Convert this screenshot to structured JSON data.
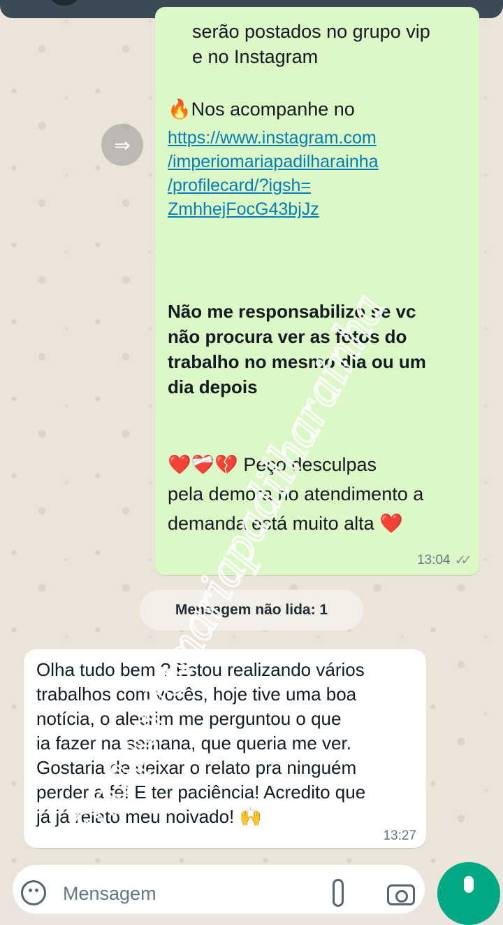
{
  "outgoing": {
    "lines_top": [
      "serão postados no grupo vip",
      "e no Instagram"
    ],
    "follow_emoji": "🔥",
    "follow_text": "Nos acompanhe no",
    "link_lines": [
      "https://www.instagram.com",
      "/imperiomariapadilharainha",
      "/profilecard/?igsh=",
      "ZmhhejFocG43bjJz"
    ],
    "bold_lines": [
      "Não me responsabilizo se vc",
      "não procura ver as fotos do",
      "trabalho no mesmo dia ou um",
      "dia depois"
    ],
    "apology_emojis": "❤️❤️‍🩹💔",
    "apology_lines": [
      "Peço desculpas",
      "pela demora no atendimento a",
      "demanda está muito alta"
    ],
    "apology_end_emoji": "❤️",
    "time": "13:04",
    "read_ticks": "✓✓"
  },
  "unread_label": "Mensagem não lida: 1",
  "incoming": {
    "lines": [
      "Olha tudo bem ? Estou realizando vários",
      "trabalhos com vocês, hoje tive uma boa",
      "notícia, o alecrim me perguntou o que",
      "ia fazer na semana, que queria me ver.",
      "Gostaria de deixar o relato pra ninguém",
      "perder a fé! E ter paciência! Acredito que",
      "já já relato meu noivado!"
    ],
    "end_emoji": "🙌",
    "time": "13:27"
  },
  "composer": {
    "placeholder": "Mensagem"
  },
  "watermark": "@imperiomariapadilharainha",
  "icons": {
    "forward": "forward-icon",
    "emoji": "emoji-icon",
    "attach": "paperclip-icon",
    "camera": "camera-icon",
    "mic": "mic-icon"
  }
}
